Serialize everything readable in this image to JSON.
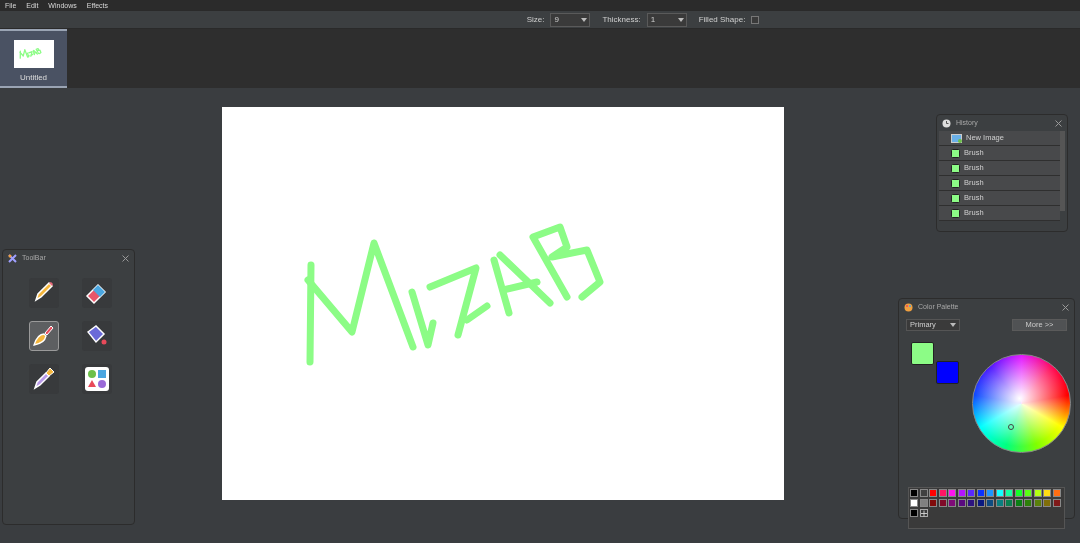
{
  "menu": [
    "File",
    "Edit",
    "Windows",
    "Effects"
  ],
  "options_bar": {
    "size": {
      "label": "Size:",
      "value": "9"
    },
    "thickness": {
      "label": "Thickness:",
      "value": "1"
    },
    "filled_shape": {
      "label": "Filled Shape:",
      "checked": false
    }
  },
  "documents": [
    {
      "title": "Untitled",
      "selected": true
    }
  ],
  "toolbar_panel": {
    "title": "ToolBar",
    "tools": [
      {
        "kind": "pencil",
        "selected": false
      },
      {
        "kind": "eraser",
        "selected": false
      },
      {
        "kind": "brush",
        "selected": true
      },
      {
        "kind": "bucket",
        "selected": false
      },
      {
        "kind": "picker",
        "selected": false
      },
      {
        "kind": "shapes",
        "selected": false
      }
    ]
  },
  "history_panel": {
    "title": "History",
    "items": [
      {
        "kind": "new-image",
        "label": "New Image"
      },
      {
        "kind": "brush",
        "label": "Brush"
      },
      {
        "kind": "brush",
        "label": "Brush"
      },
      {
        "kind": "brush",
        "label": "Brush"
      },
      {
        "kind": "brush",
        "label": "Brush"
      },
      {
        "kind": "brush",
        "label": "Brush"
      }
    ]
  },
  "color_panel": {
    "title": "Color Palette",
    "mode": "Primary",
    "more_button": "More >>",
    "primary": {
      "color": "#8cfc86"
    },
    "secondary": {
      "color": "#0000ff"
    },
    "swatches": [
      {
        "color": "#000000"
      },
      {
        "color": "#404040"
      },
      {
        "color": "#ff0000"
      },
      {
        "color": "#ff1464"
      },
      {
        "color": "#ff14f0"
      },
      {
        "color": "#b414ff"
      },
      {
        "color": "#5a28ff"
      },
      {
        "color": "#0a32ff"
      },
      {
        "color": "#1e96ff"
      },
      {
        "color": "#14ffff"
      },
      {
        "color": "#14ffa0"
      },
      {
        "color": "#14ff28"
      },
      {
        "color": "#5aff14"
      },
      {
        "color": "#b4ff14"
      },
      {
        "color": "#ffdc14"
      },
      {
        "color": "#ff6e14"
      },
      {
        "color": "#ffffff"
      },
      {
        "color": "#808080"
      },
      {
        "color": "#800a0a"
      },
      {
        "color": "#800a28"
      },
      {
        "color": "#800a78"
      },
      {
        "color": "#5a0a80"
      },
      {
        "color": "#2d1480"
      },
      {
        "color": "#0a1980"
      },
      {
        "color": "#0f4b80"
      },
      {
        "color": "#0a8080"
      },
      {
        "color": "#0a8050"
      },
      {
        "color": "#0a8014"
      },
      {
        "color": "#2d800a"
      },
      {
        "color": "#5a800a"
      },
      {
        "color": "#806e0a"
      },
      {
        "color": "#801a1a"
      },
      {
        "color": "#000000"
      }
    ]
  }
}
